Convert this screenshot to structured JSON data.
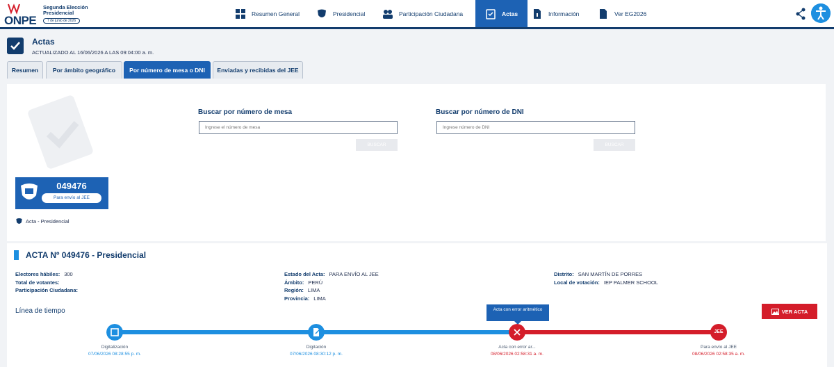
{
  "header": {
    "logo_text": "ONPE",
    "logo_title": "Segunda Elección Presidencial",
    "logo_date": "7 de junio de 2026",
    "nav": [
      {
        "label": "Resumen General",
        "icon": "dashboard-icon"
      },
      {
        "label": "Presidencial",
        "icon": "shield-emblem-icon"
      },
      {
        "label": "Participación Ciudadana",
        "icon": "people-icon"
      },
      {
        "label": "Actas",
        "icon": "checklist-icon"
      },
      {
        "label": "Información",
        "icon": "document-info-icon"
      },
      {
        "label": "Ver EG2026",
        "icon": "document-icon"
      }
    ],
    "active_nav": "Actas"
  },
  "page": {
    "title": "Actas",
    "updated": "ACTUALIZADO AL 16/06/2026 A LAS 09:04:00 a. m."
  },
  "tabs": [
    "Resumen",
    "Por ámbito geográfico",
    "Por número de mesa o DNI",
    "Enviadas y recibidas del JEE"
  ],
  "search": {
    "mesa_label": "Buscar por número de mesa",
    "mesa_placeholder": "Ingrese el número de mesa",
    "dni_label": "Buscar por número de DNI",
    "dni_placeholder": "Ingrese número de DNI",
    "button": "BUSCAR"
  },
  "result_card": {
    "number": "049476",
    "status": "Para envío al JEE",
    "caption": "Acta - Presidencial"
  },
  "acta": {
    "title": "ACTA Nº 049476 - Presidencial",
    "col1": [
      {
        "k": "Electores hábiles:",
        "v": "300"
      },
      {
        "k": "Total de votantes:",
        "v": ""
      },
      {
        "k": "Participación Ciudadana:",
        "v": ""
      }
    ],
    "col2": [
      {
        "k": "Estado del Acta:",
        "v": "PARA ENVÍO AL JEE"
      },
      {
        "k": "Ámbito:",
        "v": "PERÚ"
      },
      {
        "k": "Región:",
        "v": "LIMA"
      },
      {
        "k": "Provincia:",
        "v": "LIMA"
      }
    ],
    "col3": [
      {
        "k": "Distrito:",
        "v": "SAN MARTÍN DE PORRES"
      },
      {
        "k": "Local de votación:",
        "v": "IEP PALMER SCHOOL"
      }
    ]
  },
  "timeline": {
    "title": "Línea de tiempo",
    "ver_acta": "VER ACTA",
    "tooltip": "Acta con error aritmético",
    "steps": [
      {
        "label": "Digitalización",
        "date": "07/06/2026 08:28:55 p. m.",
        "color": "#1d8fe0",
        "icon": "scan-icon"
      },
      {
        "label": "Digitación",
        "date": "07/06/2026 08:30:12 p. m.",
        "color": "#1d8fe0",
        "icon": "edit-document-icon"
      },
      {
        "label": "Acta con error ar...",
        "date": "08/06/2026 02:58:31 a. m.",
        "color": "#d41d2a",
        "icon": "error-icon"
      },
      {
        "label": "Para envío al JEE",
        "date": "08/06/2026 02:58:35 a. m.",
        "color": "#d41d2a",
        "icon": "jee-icon",
        "node_text": "JEE"
      }
    ]
  }
}
